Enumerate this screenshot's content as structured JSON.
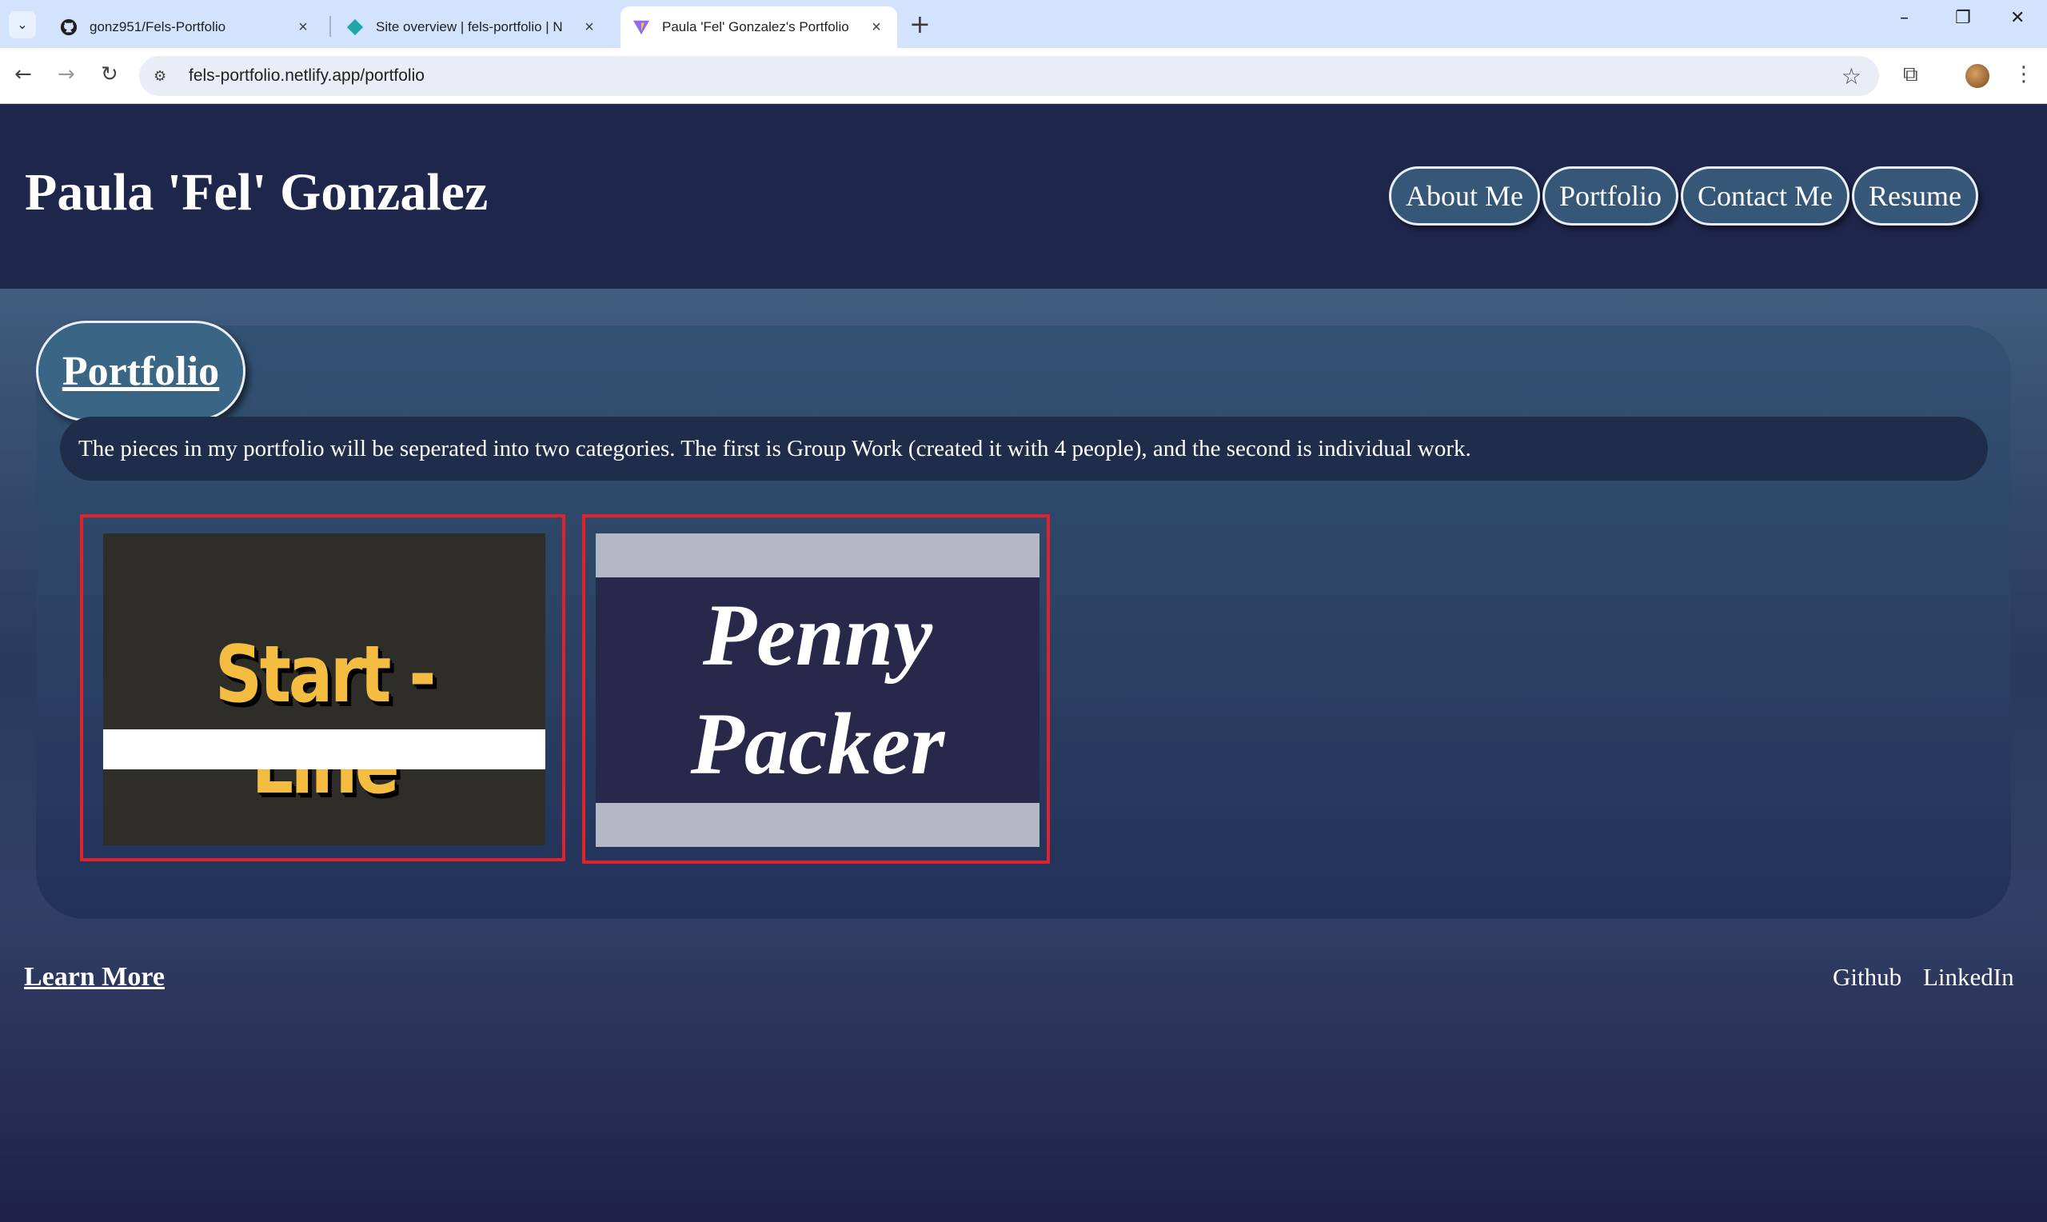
{
  "browser": {
    "tabs": [
      {
        "title": "gonz951/Fels-Portfolio",
        "icon": "github-icon"
      },
      {
        "title": "Site overview | fels-portfolio | N",
        "icon": "netlify-icon"
      },
      {
        "title": "Paula 'Fel' Gonzalez's Portfolio",
        "icon": "vite-icon"
      }
    ],
    "url": "fels-portfolio.netlify.app/portfolio"
  },
  "header": {
    "site_title": "Paula 'Fel' Gonzalez",
    "nav": [
      "About Me",
      "Portfolio",
      "Contact Me",
      "Resume"
    ]
  },
  "portfolio": {
    "heading": "Portfolio",
    "description": "The pieces in my portfolio will be seperated into two categories. The first is Group Work (created it with 4 people), and the second is individual work.",
    "projects": [
      {
        "title": "Start - Line"
      },
      {
        "line1": "Penny",
        "line2": "Packer"
      }
    ]
  },
  "footer": {
    "learn_more": "Learn More",
    "links": [
      "Github",
      "LinkedIn"
    ]
  },
  "colors": {
    "header_bg": "#1e264b",
    "nav_button": "#365777",
    "card_border": "#e0222c",
    "start_line_yellow": "#f4bd42"
  }
}
